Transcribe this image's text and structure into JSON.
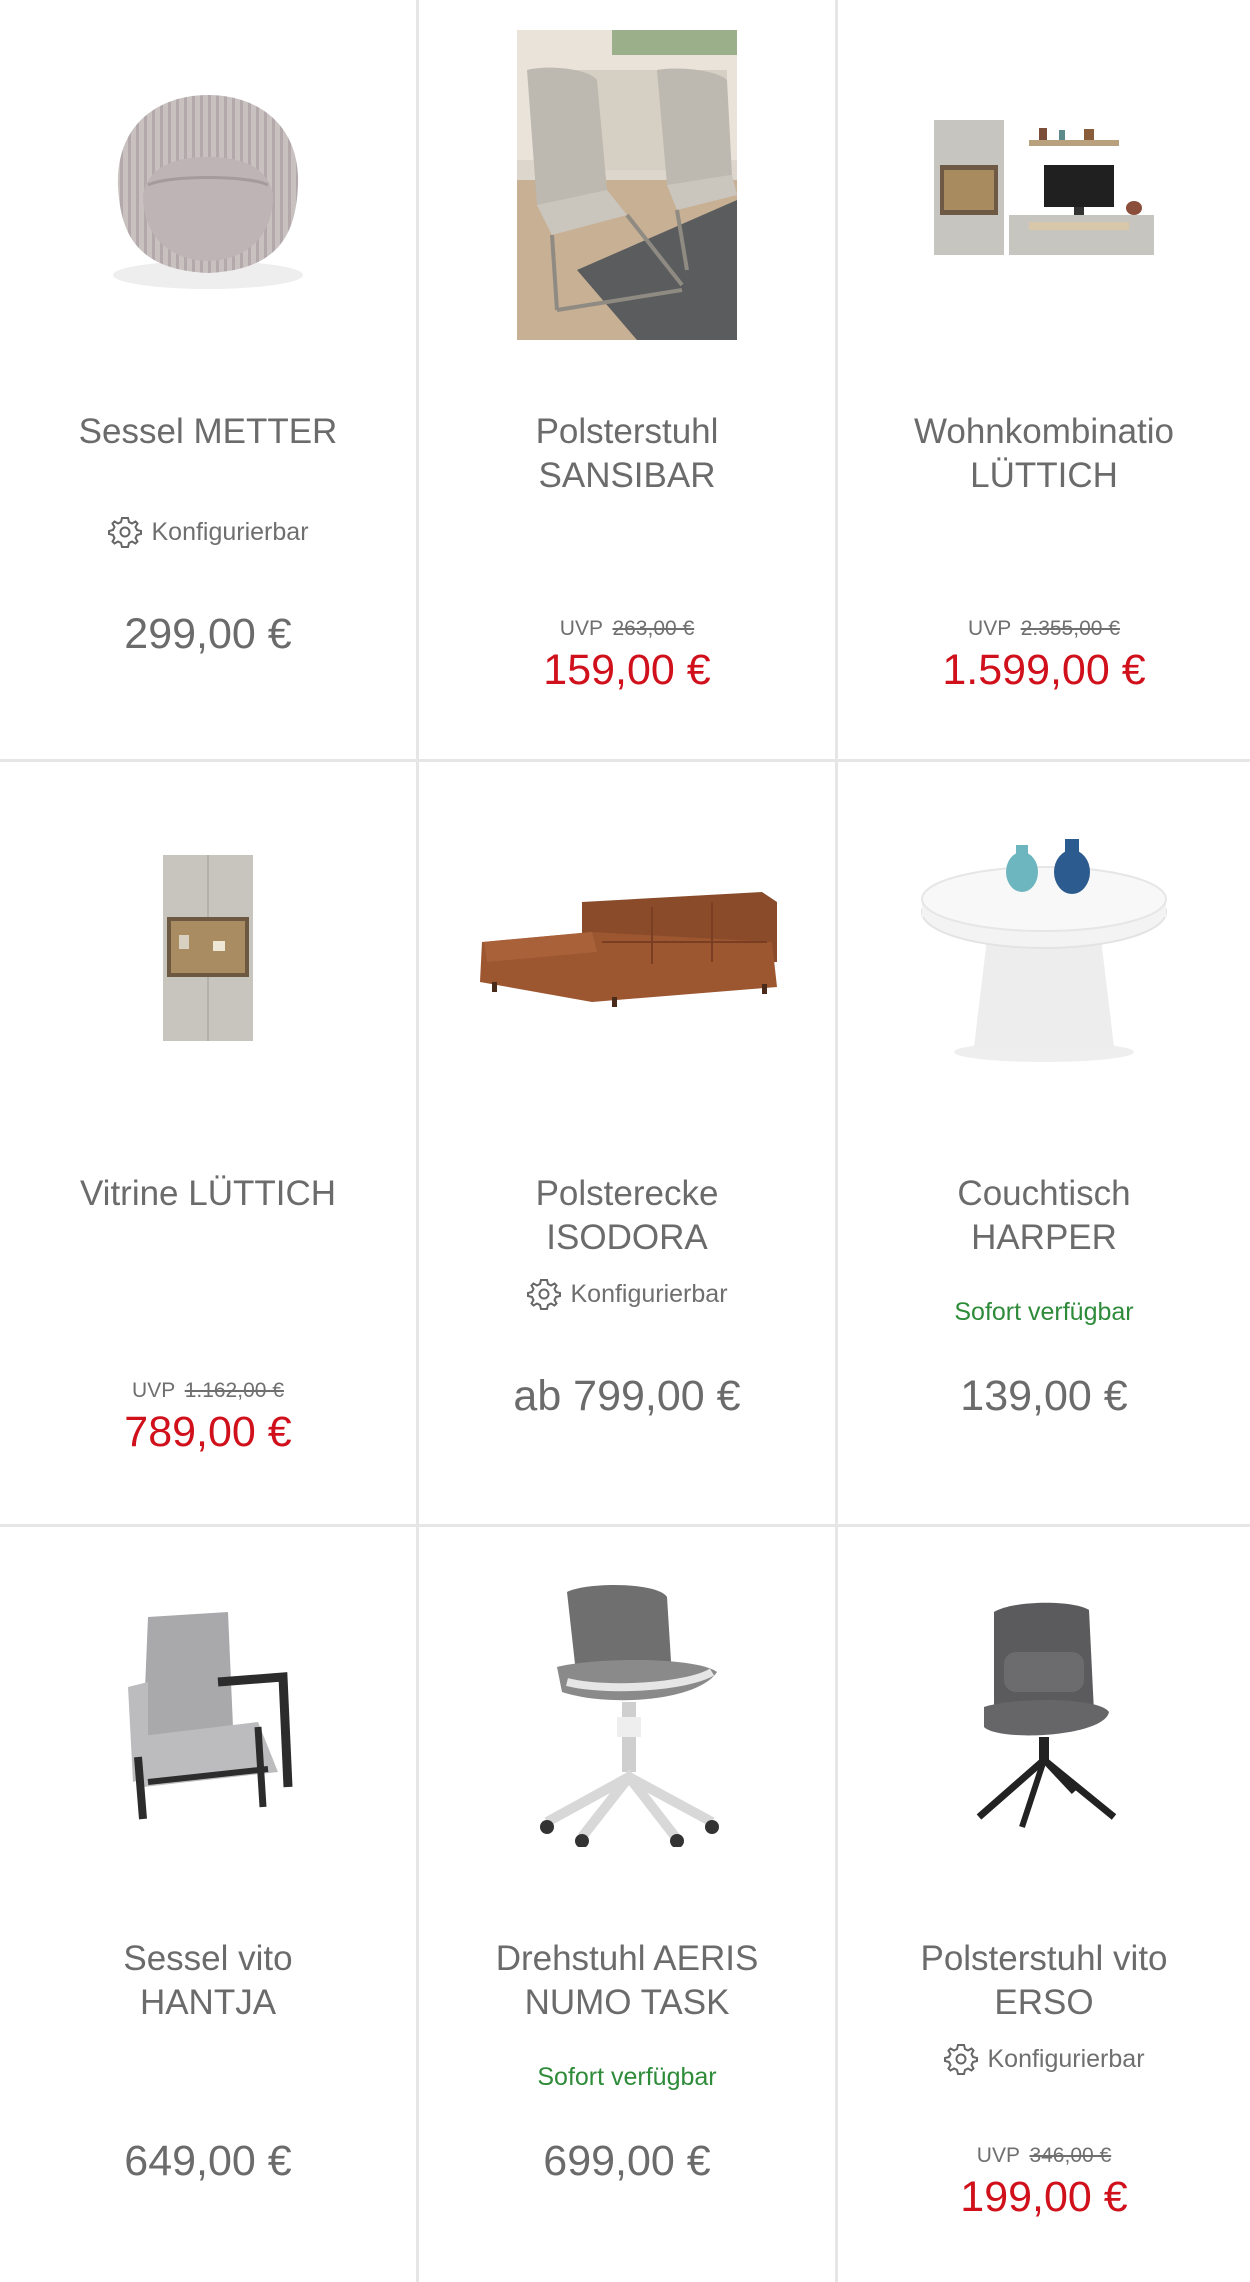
{
  "products": [
    {
      "title": "Sessel METTER",
      "configurable": true,
      "config_label": "Konfigurierbar",
      "price": "299,00 €",
      "image": "armchair-round-image"
    },
    {
      "title": "Polsterstuhl\nSANSIBAR",
      "uvp_label": "UVP",
      "uvp_price": "263,00 €",
      "price": "159,00 €",
      "image": "upholstered-chair-image"
    },
    {
      "title": "Wohnkombinatio\nLÜTTICH",
      "uvp_label": "UVP",
      "uvp_price": "2.355,00 €",
      "price": "1.599,00 €",
      "image": "living-wall-unit-image"
    },
    {
      "title": "Vitrine LÜTTICH",
      "uvp_label": "UVP",
      "uvp_price": "1.162,00 €",
      "price": "789,00 €",
      "image": "display-cabinet-image"
    },
    {
      "title": "Polsterecke\nISODORA",
      "configurable": true,
      "config_label": "Konfigurierbar",
      "price": "ab 799,00 €",
      "image": "corner-sofa-image"
    },
    {
      "title": "Couchtisch\nHARPER",
      "availability": "Sofort verfügbar",
      "price": "139,00 €",
      "image": "coffee-table-image"
    },
    {
      "title": "Sessel vito\nHANTJA",
      "price": "649,00 €",
      "image": "lounge-armchair-image"
    },
    {
      "title": "Drehstuhl AERIS\nNUMO TASK",
      "availability": "Sofort verfügbar",
      "price": "699,00 €",
      "image": "office-chair-image"
    },
    {
      "title": "Polsterstuhl vito\nERSO",
      "configurable": true,
      "config_label": "Konfigurierbar",
      "uvp_label": "UVP",
      "uvp_price": "346,00 €",
      "price": "199,00 €",
      "image": "swivel-chair-image"
    }
  ],
  "colors": {
    "sale": "#d0101b",
    "available": "#2e8b3a",
    "text": "#6b6b6b",
    "divider": "#e6e6e6"
  }
}
